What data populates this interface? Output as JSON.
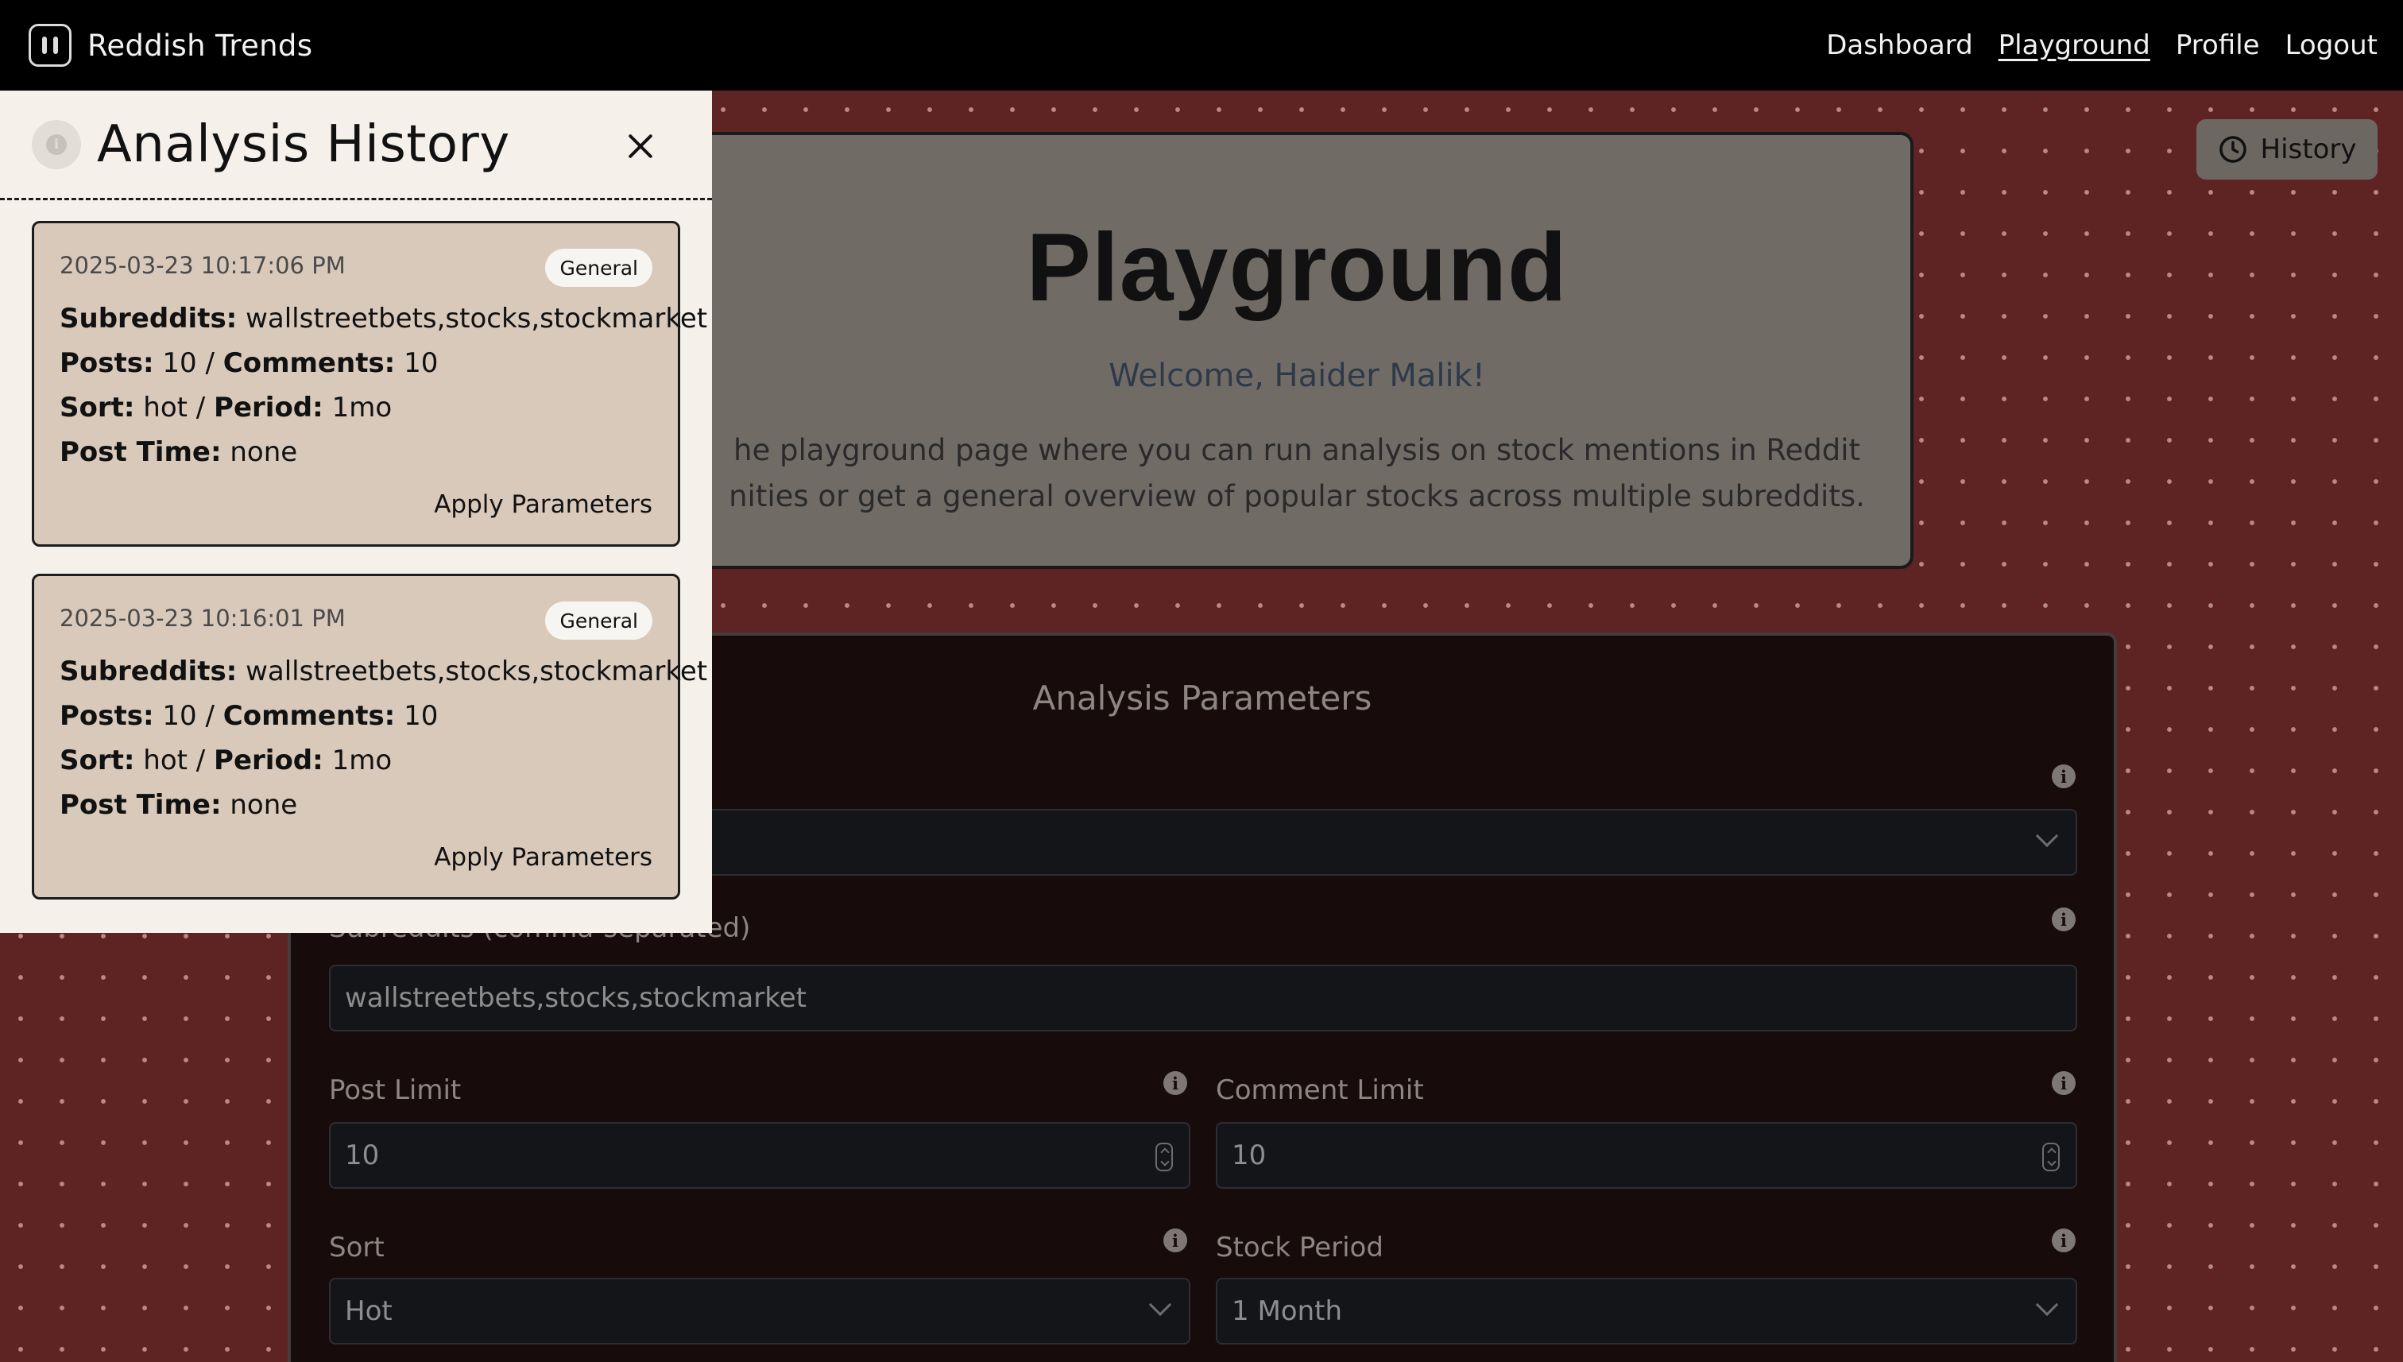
{
  "nav": {
    "brand": "Reddish Trends",
    "links": [
      "Dashboard",
      "Playground",
      "Profile",
      "Logout"
    ],
    "active": "Playground"
  },
  "hero": {
    "title": "Playground",
    "welcome": "Welcome, Haider Malik!",
    "desc_line1": "he playground page where you can run analysis on stock mentions in Reddit",
    "desc_line2": "nities or get a general overview of popular stocks across multiple subreddits."
  },
  "history_button": "History",
  "params": {
    "title": "Analysis Parameters",
    "subreddits_label": "Subreddits (comma-separated)",
    "subreddits_value": "wallstreetbets,stocks,stockmarket",
    "post_limit_label": "Post Limit",
    "post_limit_value": "10",
    "comment_limit_label": "Comment Limit",
    "comment_limit_value": "10",
    "sort_label": "Sort",
    "sort_value": "Hot",
    "stock_period_label": "Stock Period",
    "stock_period_value": "1 Month"
  },
  "drawer": {
    "title": "Analysis History",
    "apply_label": "Apply Parameters",
    "labels": {
      "subreddits": "Subreddits:",
      "posts": "Posts:",
      "comments": "Comments:",
      "sort": "Sort:",
      "period": "Period:",
      "post_time": "Post Time:"
    },
    "items": [
      {
        "timestamp": "2025-03-23 10:17:06 PM",
        "badge": "General",
        "subreddits": "wallstreetbets,stocks,stockmarket",
        "posts": "10",
        "comments": "10",
        "sort": "hot",
        "period": "1mo",
        "post_time": "none"
      },
      {
        "timestamp": "2025-03-23 10:16:01 PM",
        "badge": "General",
        "subreddits": "wallstreetbets,stocks,stockmarket",
        "posts": "10",
        "comments": "10",
        "sort": "hot",
        "period": "1mo",
        "post_time": "none"
      }
    ]
  },
  "colors": {
    "background": "#5e2424",
    "navbar": "#000000",
    "drawer": "#f5f0e9",
    "history_card": "#d8c9bb",
    "params_panel": "#170b0b"
  },
  "icons": {
    "brand": "reddish-logo-icon",
    "history": "clock-icon",
    "close": "close-icon",
    "info": "info-icon",
    "chevron": "chevron-down-icon"
  }
}
